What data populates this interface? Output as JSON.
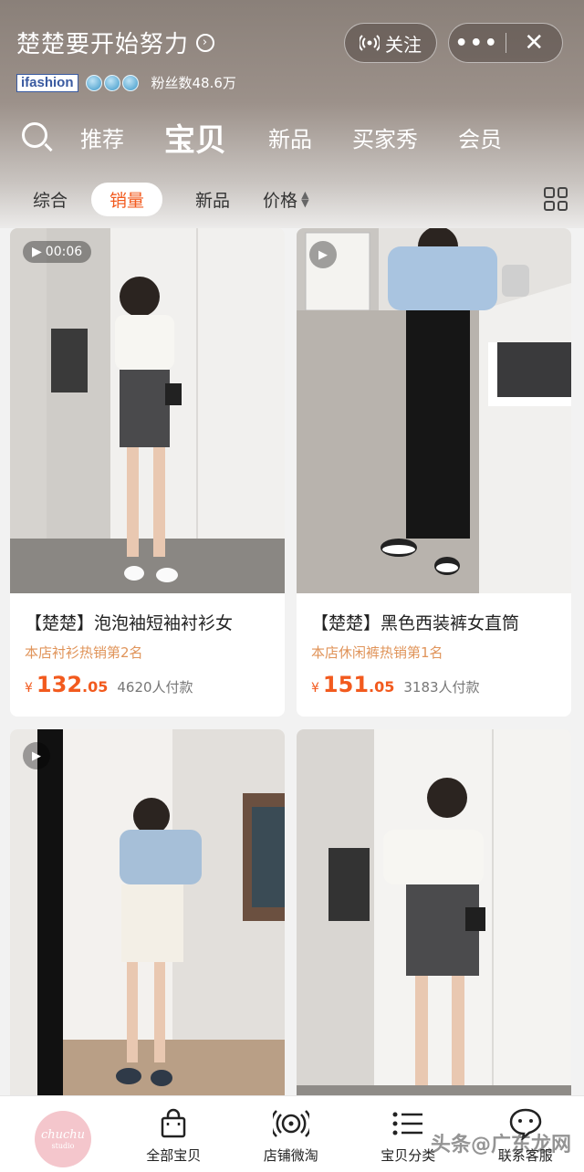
{
  "header": {
    "shop_name": "楚楚要开始努力",
    "follow_label": "关注",
    "more_label": "•••",
    "close_label": "✕",
    "badge_text": "ifashion",
    "fans_text": "粉丝数48.6万"
  },
  "nav": {
    "tabs": [
      {
        "label": "推荐",
        "active": false
      },
      {
        "label": "宝贝",
        "active": true
      },
      {
        "label": "新品",
        "active": false
      },
      {
        "label": "买家秀",
        "active": false
      },
      {
        "label": "会员",
        "active": false
      }
    ]
  },
  "sort": {
    "items": [
      {
        "label": "综合"
      },
      {
        "label": "销量",
        "active": true
      },
      {
        "label": "新品"
      },
      {
        "label": "价格"
      }
    ]
  },
  "products": [
    {
      "title": "【楚楚】泡泡袖短袖衬衫女",
      "rank": "本店衬衫热销第2名",
      "yen": "¥",
      "price_int": "132",
      "price_dec": ".05",
      "sold": "4620人付款",
      "video": "00:06"
    },
    {
      "title": "【楚楚】黑色西装裤女直筒",
      "rank": "本店休闲裤热销第1名",
      "yen": "¥",
      "price_int": "151",
      "price_dec": ".05",
      "sold": "3183人付款"
    }
  ],
  "bottom_bar": {
    "logo_line1": "chuchu",
    "logo_line2": "studio",
    "items": [
      {
        "label": "全部宝贝",
        "icon": "shopping-bag-icon"
      },
      {
        "label": "店铺微淘",
        "icon": "broadcast-icon"
      },
      {
        "label": "宝贝分类",
        "icon": "list-icon"
      },
      {
        "label": "联系客服",
        "icon": "chat-icon"
      }
    ]
  },
  "watermark": "头条@广东龙网"
}
